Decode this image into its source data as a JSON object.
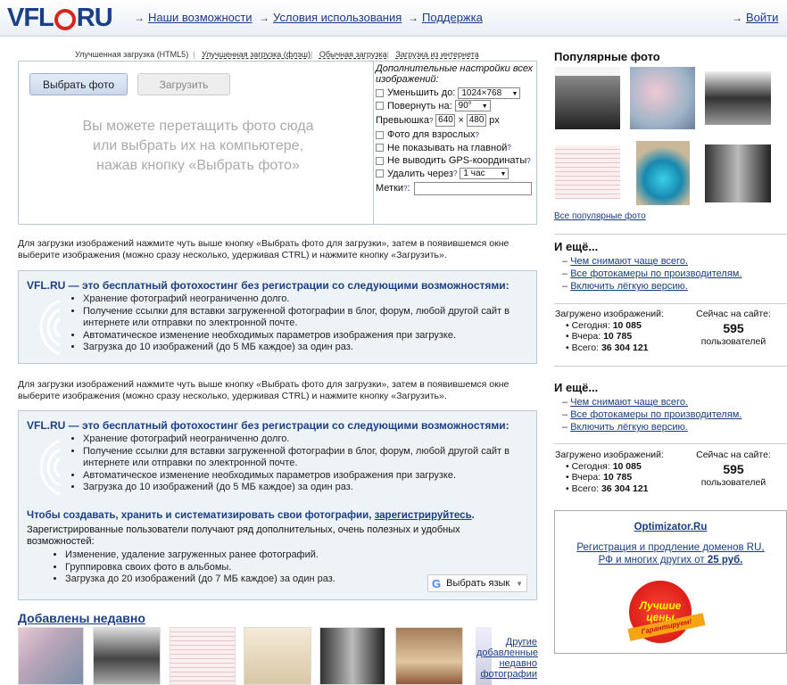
{
  "logo": {
    "text_left": "VFL",
    "text_right": "RU"
  },
  "nav": {
    "features": "Наши возможности",
    "terms": "Условия использования",
    "support": "Поддержка",
    "login": "Войти"
  },
  "tabs": [
    "Улучшенная загрузка (HTML5)",
    "Улучшенная загрузка (флэш)",
    "Обычная загрузка",
    "Загрузка из интернета"
  ],
  "uploader": {
    "pick_button": "Выбрать фото",
    "upload_button": "Загрузить",
    "drop_text": [
      "Вы можете перетащить фото сюда",
      "или выбрать их на компьютере,",
      "нажав кнопку «Выбрать фото»"
    ]
  },
  "options": {
    "header": "Дополнительные настройки всех изображений:",
    "resize_label": "Уменьшить до:",
    "resize_value": "1024×768",
    "rotate_label": "Повернуть на:",
    "rotate_value": "90°",
    "preview_label": "Превьюшка",
    "preview_w": "640",
    "preview_x": "×",
    "preview_h": "480",
    "preview_unit": "px",
    "adult": "Фото для взрослых",
    "hide_main": "Не показывать на главной",
    "no_gps": "Не выводить GPS-координаты",
    "delete_label": "Удалить через",
    "delete_value": "1 час",
    "tags_label": "Метки"
  },
  "info_text": "Для загрузки изображений нажмите чуть выше кнопку «Выбрать фото для загрузки», затем в появившемся окне выберите изображения (можно сразу несколько, удерживая CTRL) и нажмите кнопку «Загрузить».",
  "box": {
    "title": "VFL.RU — это бесплатный фотохостинг без регистрации со следующими возможностями:",
    "items": [
      "Хранение фотографий неограниченно долго.",
      "Получение ссылки для вставки загруженной фотографии в блог, форум, любой другой сайт в интернете или отправки по электронной почте.",
      "Автоматическое изменение необходимых параметров изображения при загрузке.",
      "Загрузка до 10 изображений (до 5 МБ каждое) за один раз."
    ]
  },
  "register": {
    "lead": "Чтобы создавать, хранить и систематизировать свои фотографии,",
    "link": "зарегистрируйтесь",
    "lead_end": ".",
    "sub": "Зарегистрированные пользователи получают ряд дополнительных, очень полезных и удобных возможностей:",
    "items": [
      "Изменение, удаление загруженных ранее фотографий.",
      "Группировка своих фото в альбомы.",
      "Загрузка до 20 изображений (до 7 МБ каждое) за один раз."
    ]
  },
  "google_translate": {
    "g": "G",
    "label": "Выбрать язык"
  },
  "recent": {
    "title": "Добавлены недавно",
    "other": "Другие добавленные недавно фотографии"
  },
  "sidebar": {
    "popular_title": "Популярные фото",
    "all_popular": "Все популярные фото",
    "more_title": "И ещё...",
    "links": [
      "Чем снимают чаще всего.",
      "Все фотокамеры по производителям.",
      "Включить лёгкую версию."
    ],
    "uploaded_label": "Загружено изображений:",
    "today": "Сегодня:",
    "today_val": "10 085",
    "yesterday": "Вчера:",
    "yesterday_val": "10 785",
    "total": "Всего:",
    "total_val": "36 304 121",
    "online_label": "Сейчас на сайте:",
    "online_val": "595",
    "online_unit": "пользователей"
  },
  "ad": {
    "title": "Optimizator.Ru",
    "line1": "Регистрация и продление доменов RU,",
    "line2": "РФ и многих других от",
    "price": "25 руб.",
    "badge1": "Лучшие",
    "badge2": "цены",
    "ribbon": "Гарантируем!"
  }
}
